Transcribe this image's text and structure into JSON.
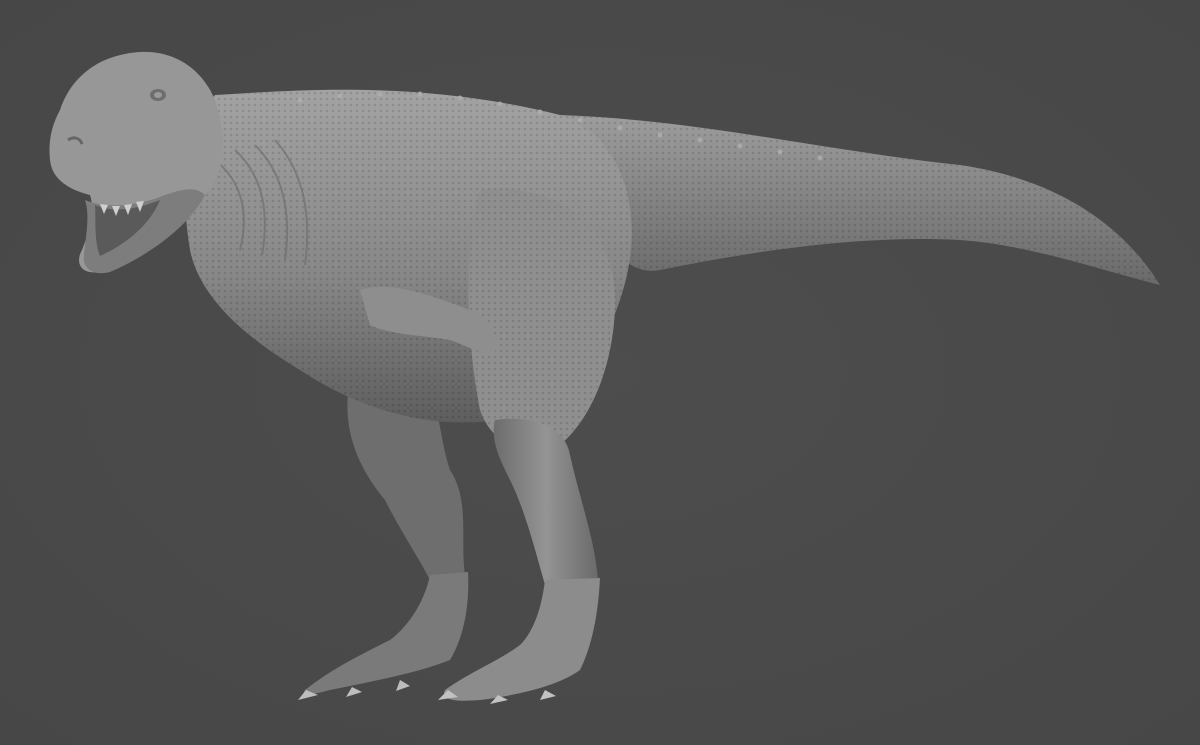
{
  "scene": {
    "background_color": "#4a4a4a",
    "subject": "sculpted-tyrannosaur-model",
    "material_color": "#8a8a8a",
    "shadow_color": "#3a3a3a",
    "highlight_color": "#b5b5b5"
  }
}
